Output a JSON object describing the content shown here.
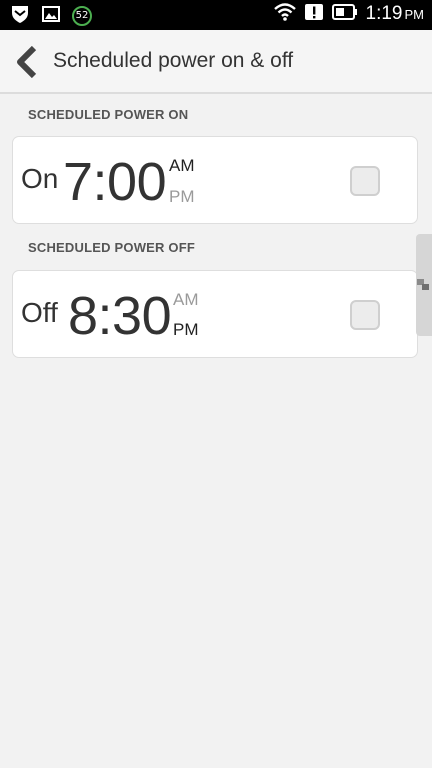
{
  "status_bar": {
    "notification_badge": "52",
    "time": "1:19",
    "time_suffix": "PM"
  },
  "header": {
    "title": "Scheduled power on & off"
  },
  "sections": {
    "power_on": {
      "header": "SCHEDULED POWER ON",
      "state_label": "On",
      "time": "7:00",
      "am_label": "AM",
      "pm_label": "PM",
      "selected_meridiem": "AM",
      "enabled": false
    },
    "power_off": {
      "header": "SCHEDULED POWER OFF",
      "state_label": "Off",
      "time": "8:30",
      "am_label": "AM",
      "pm_label": "PM",
      "selected_meridiem": "PM",
      "enabled": false
    }
  },
  "icons": {
    "status_left": [
      "shield-icon",
      "image-notification-icon",
      "badge-52-icon"
    ],
    "status_right": [
      "wifi-icon",
      "alert-icon",
      "battery-icon"
    ],
    "nav": "back-chevron-icon"
  },
  "colors": {
    "badge_ring": "#4caf50",
    "status_bar_bg": "#000000",
    "page_bg": "#f2f2f2"
  }
}
